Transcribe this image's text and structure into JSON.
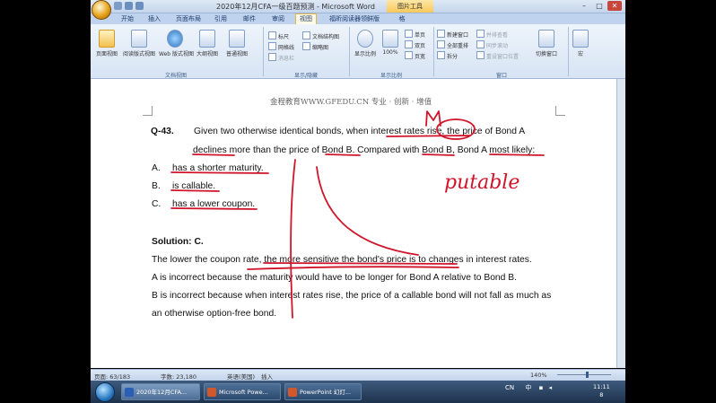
{
  "window": {
    "title": "2020年12月CFA一级百题预测 - Microsoft Word",
    "picture_tools_tab": "图片工具",
    "controls": [
      "–",
      "□",
      "✕"
    ]
  },
  "ribbon": {
    "tabs": [
      "开始",
      "插入",
      "页面布局",
      "引用",
      "邮件",
      "审阅",
      "视图",
      "福昕阅读器领鲜版",
      "格"
    ],
    "active_tab": "视图",
    "groups": {
      "doc_views": {
        "label": "文档视图",
        "buttons": [
          "页面视图",
          "阅读版式视图",
          "Web 版式视图",
          "大纲视图",
          "普通视图"
        ]
      },
      "show_hide": {
        "label": "显示/隐藏",
        "items": [
          "标尺",
          "网格线",
          "消息栏",
          "文档结构图",
          "缩略图"
        ]
      },
      "zoom": {
        "label": "显示比例",
        "buttons": [
          "显示比例",
          "100%"
        ],
        "items": [
          "单页",
          "双页",
          "页宽"
        ]
      },
      "window": {
        "label": "窗口",
        "items": [
          "新建窗口",
          "全部重排",
          "拆分",
          "并排查看",
          "同步滚动",
          "重设窗口位置"
        ],
        "buttons": [
          "切换窗口"
        ]
      },
      "macro": {
        "buttons": [
          "宏"
        ]
      }
    }
  },
  "document": {
    "header": "金程教育WWW.GFEDU.CN 专业 · 创新 · 增值",
    "question_number": "Q-43.",
    "question_line1": "Given two otherwise identical bonds, when interest rates rise, the price of Bond A",
    "question_line2": "declines more than the price of Bond B. Compared with Bond B, Bond A most likely:",
    "options": [
      {
        "letter": "A.",
        "text": "has a shorter maturity."
      },
      {
        "letter": "B.",
        "text": "is callable."
      },
      {
        "letter": "C.",
        "text": "has a lower coupon."
      }
    ],
    "solution_label": "Solution: C.",
    "solution_lines": [
      "The lower the coupon rate, the more sensitive the bond's price is to changes in interest rates.",
      "A is incorrect because the maturity would have to be longer for Bond A relative to Bond B.",
      "B is incorrect because when interest rates rise, the price of a callable bond will not fall as much as",
      "an otherwise option-free bond."
    ],
    "handwriting": "putable"
  },
  "statusbar": {
    "page": "页面: 63/183",
    "words": "字数: 23,180",
    "language": "英语(美国)",
    "mode": "插入",
    "zoom": "140%"
  },
  "taskbar": {
    "tasks": [
      "2020年12月CFA...",
      "Microsoft Powe...",
      "PowerPoint 幻灯..."
    ],
    "tray": "CN",
    "ime": "中",
    "clock_time": "11:11",
    "clock_date": "8"
  },
  "colors": {
    "ink": "#d0152b",
    "ribbon_bg": "#dbe6f4",
    "taskbar": "#263e5c"
  }
}
